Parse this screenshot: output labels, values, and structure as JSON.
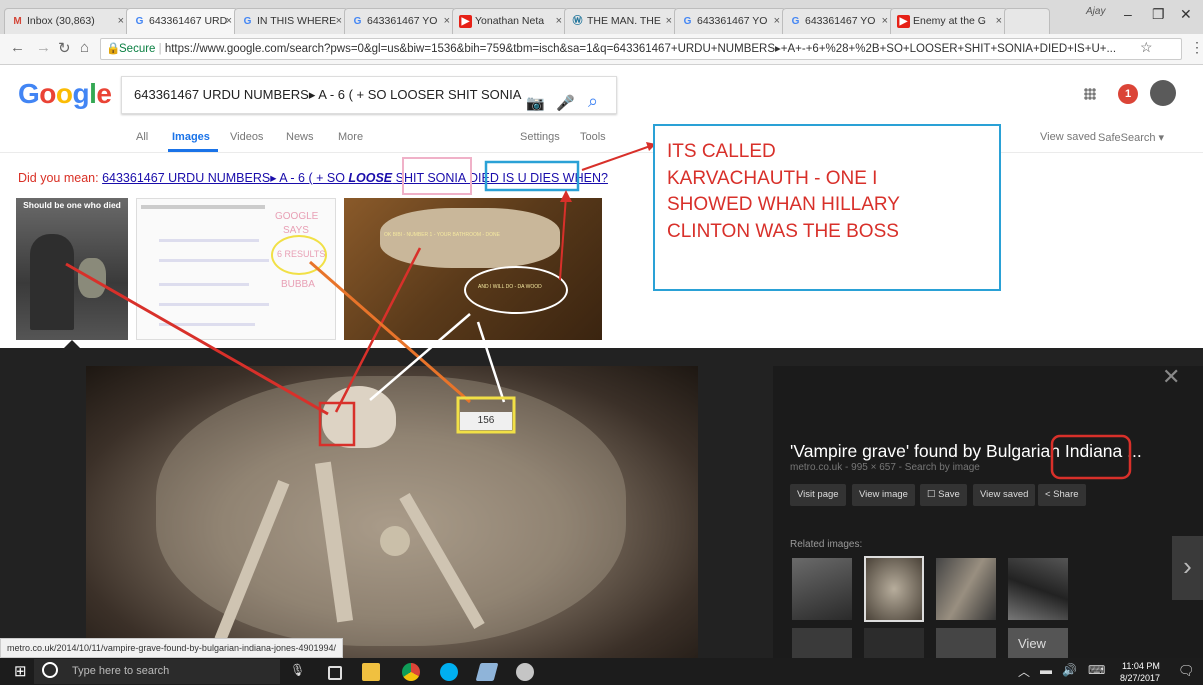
{
  "tabs": [
    {
      "label": "Inbox (30,863)",
      "icon": "gmail-icon"
    },
    {
      "label": "643361467 URD",
      "icon": "google-icon"
    },
    {
      "label": "IN THIS WHERE",
      "icon": "google-icon"
    },
    {
      "label": "643361467 YO",
      "icon": "google-icon"
    },
    {
      "label": "Yonathan Neta",
      "icon": "youtube-icon"
    },
    {
      "label": "THE MAN. THE",
      "icon": "wordpress-icon"
    },
    {
      "label": "643361467 YO",
      "icon": "google-icon"
    },
    {
      "label": "643361467 YO",
      "icon": "google-icon"
    },
    {
      "label": "Enemy at the G",
      "icon": "youtube-icon"
    }
  ],
  "profile_label": "Ajay",
  "address": {
    "secure_label": "Secure",
    "url": "https://www.google.com/search?pws=0&gl=us&biw=1536&bih=759&tbm=isch&sa=1&q=643361467+URDU+NUMBERS▸+A+-+6+%28+%2B+SO+LOOSER+SHIT+SONIA+DIED+IS+U+..."
  },
  "logo": "Google",
  "search": {
    "query": "643361467 URDU NUMBERS▸ A - 6 ( + SO LOOSER SHIT SONIA"
  },
  "header": {
    "notification_count": "1"
  },
  "nav": {
    "all": "All",
    "images": "Images",
    "videos": "Videos",
    "news": "News",
    "more": "More",
    "settings": "Settings",
    "tools": "Tools",
    "view_saved": "View saved",
    "safesearch": "SafeSearch ▾"
  },
  "did_you_mean": {
    "prefix": "Did you mean: ",
    "part1": "643361467 URDU NUMBERS▸ A - 6 ( + SO ",
    "bold": "LOOSE",
    "part2": " SHIT SONIA DIED IS U DIES WHEN?"
  },
  "thumbs": {
    "t1_caption": "Should be one who died",
    "t2_lines": [
      "GOOGLE",
      "SAYS",
      "6 RESULTS",
      "BUBBA"
    ],
    "t3_line1": "OK BIBI - NUMBER 1 - YOUR BATHROOM - DONE",
    "t3_line2": "AND I WILL DO - DA WOOD"
  },
  "annotation": {
    "lines": [
      "ITS CALLED",
      "KARVACHAUTH - ONE I",
      "SHOWED WHAN HILLARY",
      "CLINTON WAS THE BOSS"
    ]
  },
  "main_image": {
    "tag": "156"
  },
  "panel": {
    "title": "'Vampire grave' found by Bulgarian Indiana ...",
    "source": "metro.co.uk - 995 × 657 - Search by image",
    "buttons": {
      "visit": "Visit page",
      "view": "View image",
      "save": "☐ Save",
      "saved": "View saved",
      "share": "< Share"
    },
    "related_label": "Related images:",
    "view_more": "View"
  },
  "status_url": "metro.co.uk/2014/10/11/vampire-grave-found-by-bulgarian-indiana-jones-4901994/",
  "taskbar": {
    "search_placeholder": "Type here to search",
    "time": "11:04 PM",
    "date": "8/27/2017"
  },
  "colors": {
    "annotation_red": "#d8302a",
    "annotation_blue": "#2aa1d6",
    "google_blue": "#4285f4"
  }
}
